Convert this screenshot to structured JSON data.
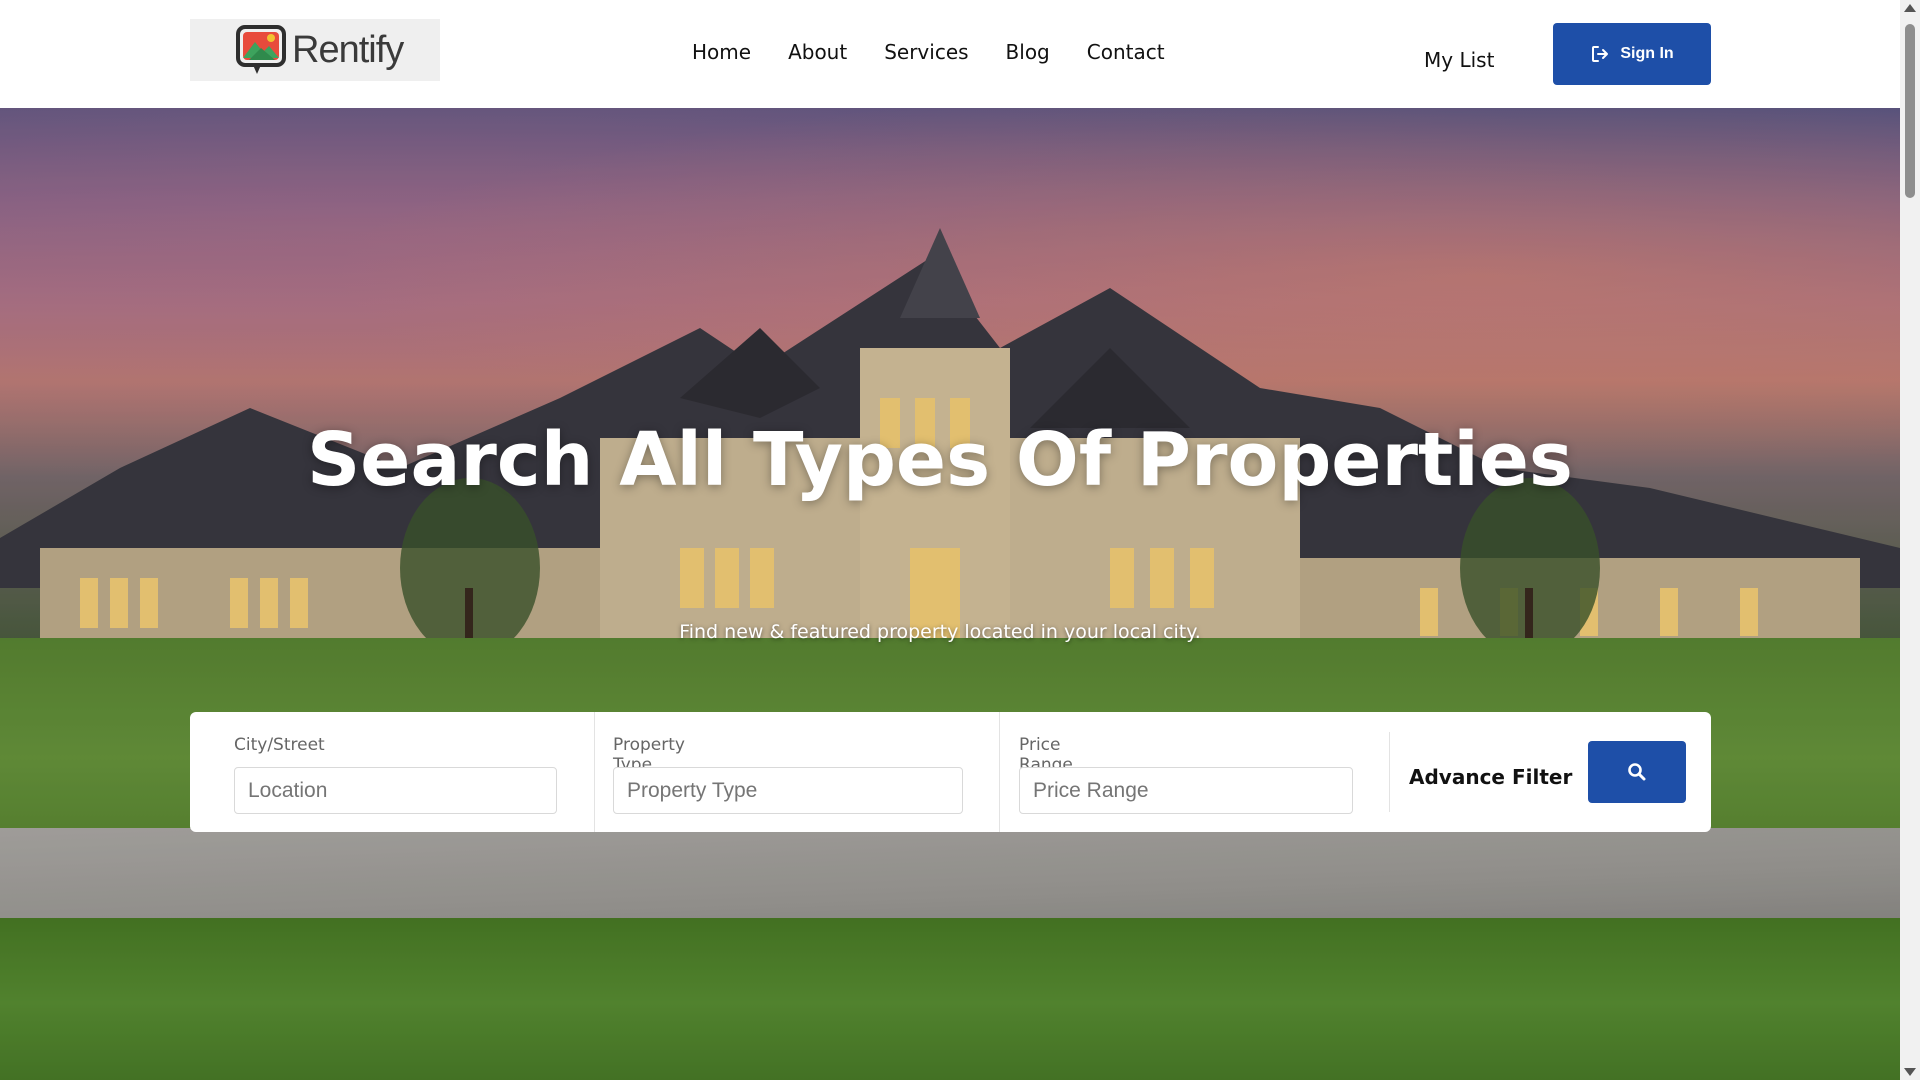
{
  "brand": {
    "name": "Rentify",
    "accent": "#1e4fa8"
  },
  "nav": {
    "items": [
      {
        "label": "Home"
      },
      {
        "label": "About"
      },
      {
        "label": "Services"
      },
      {
        "label": "Blog"
      },
      {
        "label": "Contact"
      }
    ],
    "my_list": "My List",
    "sign_in": "Sign In",
    "sign_in_icon": "sign-in-icon"
  },
  "hero": {
    "title": "Search All Types Of Properties",
    "subtitle": "Find new & featured property located in your local city."
  },
  "search": {
    "city": {
      "label": "City/Street",
      "placeholder": "Location"
    },
    "type": {
      "label": "Property Type",
      "placeholder": "Property Type"
    },
    "price": {
      "label": "Price Range",
      "placeholder": "Price Range"
    },
    "advance_filter": "Advance Filter",
    "button_icon": "search-icon"
  }
}
